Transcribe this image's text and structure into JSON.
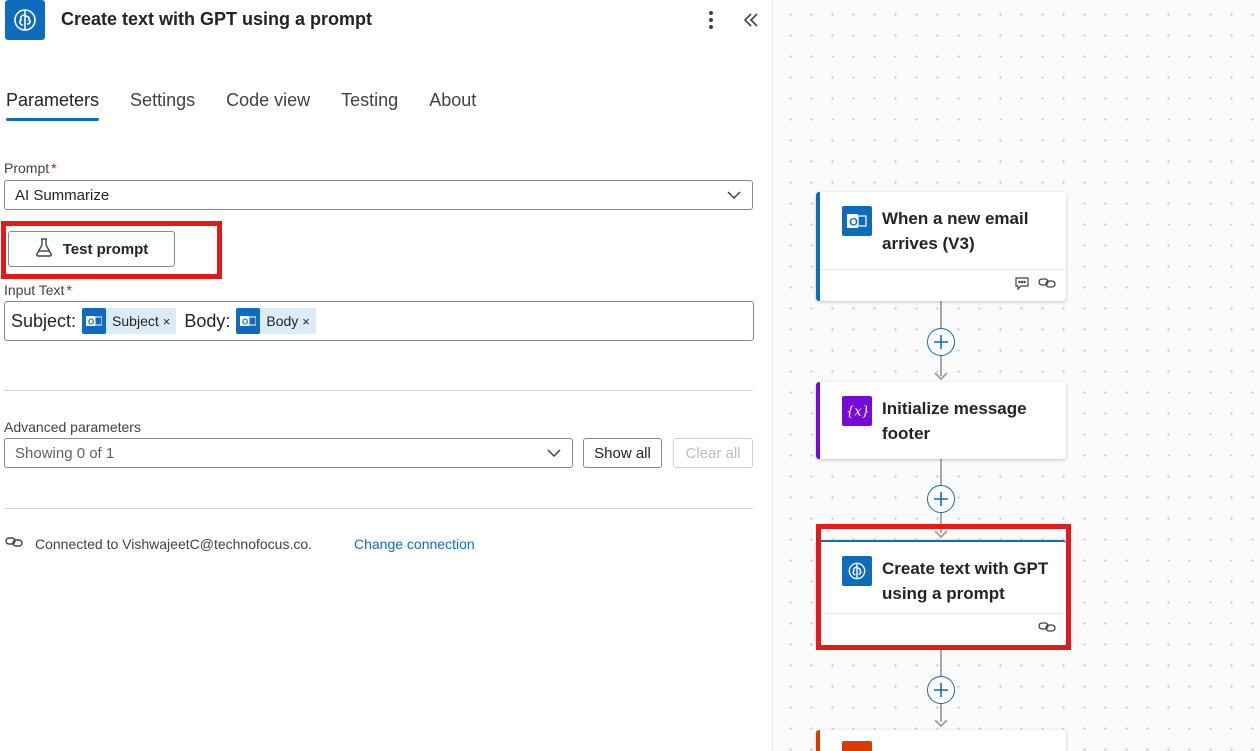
{
  "panel": {
    "title": "Create text with GPT using a prompt",
    "tabs": [
      "Parameters",
      "Settings",
      "Code view",
      "Testing",
      "About"
    ],
    "active_tab": "Parameters",
    "prompt_label": "Prompt",
    "required_mark": "*",
    "prompt_value": "AI Summarize",
    "test_prompt_label": "Test prompt",
    "input_text_label": "Input Text",
    "input_text": {
      "subject_prefix": "Subject:",
      "subject_token": "Subject",
      "body_prefix": "Body:",
      "body_token": "Body",
      "remove_glyph": "×"
    },
    "advanced_label": "Advanced parameters",
    "advanced_value": "Showing 0 of 1",
    "show_all_label": "Show all",
    "clear_all_label": "Clear all",
    "connection_text": "Connected to VishwajeetC@technofocus.co.",
    "change_connection_label": "Change connection"
  },
  "flow": {
    "cards": [
      {
        "title": "When a new email arrives (V3)",
        "icon": "outlook-icon",
        "accent": "#0f6cbd"
      },
      {
        "title": "Initialize message footer",
        "icon": "variable-icon",
        "accent": "#770bd6"
      },
      {
        "title": "Create text with GPT using a prompt",
        "icon": "ai-brain-icon",
        "accent": "#0f6cbd"
      }
    ]
  },
  "colors": {
    "brand": "#0f6cbd",
    "highlight": "#e3191c",
    "variable": "#770bd6",
    "office": "#d83b01"
  }
}
